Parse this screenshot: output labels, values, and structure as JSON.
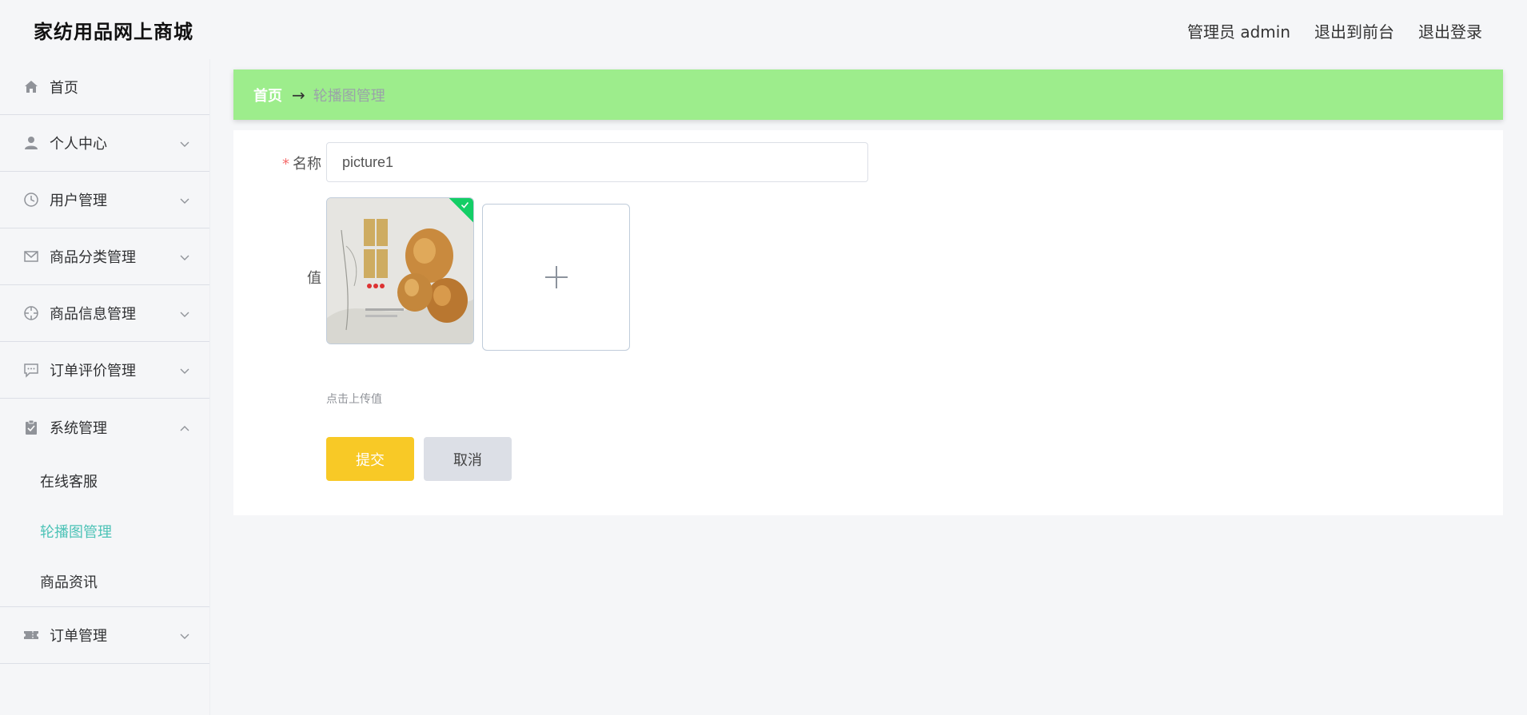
{
  "app": {
    "title": "家纺用品网上商城"
  },
  "header": {
    "admin_label": "管理员 admin",
    "to_front_label": "退出到前台",
    "logout_label": "退出登录"
  },
  "sidebar": {
    "items": [
      {
        "label": "首页",
        "icon": "home-icon"
      },
      {
        "label": "个人中心",
        "icon": "user-icon"
      },
      {
        "label": "用户管理",
        "icon": "clock-icon"
      },
      {
        "label": "商品分类管理",
        "icon": "mail-icon"
      },
      {
        "label": "商品信息管理",
        "icon": "target-icon"
      },
      {
        "label": "订单评价管理",
        "icon": "chat-icon"
      },
      {
        "label": "系统管理",
        "icon": "clipboard-icon",
        "expanded": true,
        "children": [
          {
            "label": "在线客服"
          },
          {
            "label": "轮播图管理",
            "active": true
          },
          {
            "label": "商品资讯"
          }
        ]
      },
      {
        "label": "订单管理",
        "icon": "ticket-icon"
      }
    ]
  },
  "breadcrumb": {
    "home": "首页",
    "current": "轮播图管理"
  },
  "form": {
    "name_label": "名称",
    "name_value": "picture1",
    "value_label": "值",
    "upload_hint": "点击上传值",
    "submit_label": "提交",
    "cancel_label": "取消"
  },
  "colors": {
    "breadcrumb_bg": "#9ded8c",
    "active_menu": "#4dc3b7",
    "submit_bg": "#f8c926",
    "cancel_bg": "#dcdfe6",
    "required": "#f56c6c",
    "upload_success": "#13ce66"
  }
}
